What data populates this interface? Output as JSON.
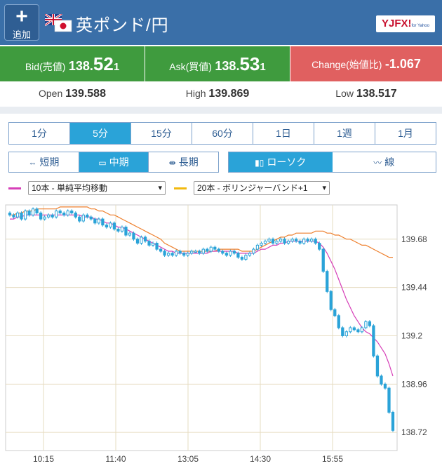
{
  "header": {
    "add_label": "追加",
    "pair_title": "英ポンド/円",
    "logo_text": "YJFX!",
    "logo_sub": "for Yahoo"
  },
  "quote": {
    "bid_label": "Bid(売値)",
    "bid_prefix": "138.",
    "bid_big": "52",
    "bid_small": "1",
    "ask_label": "Ask(買値)",
    "ask_prefix": "138.",
    "ask_big": "53",
    "ask_small": "1",
    "change_label": "Change(始値比)",
    "change_value": "-1.067",
    "colors": {
      "bid_ask_bg": "#3f9b3e",
      "change_bg": "#e06060"
    }
  },
  "stats": {
    "open_label": "Open",
    "open_value": "139.588",
    "high_label": "High",
    "high_value": "139.869",
    "low_label": "Low",
    "low_value": "138.517"
  },
  "timeframes": [
    "1分",
    "5分",
    "15分",
    "60分",
    "1日",
    "1週",
    "1月"
  ],
  "active_timeframe": "5分",
  "terms": [
    {
      "icon": "arrows-in-icon",
      "label": "短期"
    },
    {
      "icon": "window-icon",
      "label": "中期"
    },
    {
      "icon": "arrows-out-icon",
      "label": "長期"
    }
  ],
  "active_term": "中期",
  "chart_styles": [
    {
      "icon": "candlestick-icon",
      "label": "ローソク"
    },
    {
      "icon": "line-chart-icon",
      "label": "線"
    }
  ],
  "active_style": "ローソク",
  "indicators": [
    {
      "selected": "10本 - 単純平均移動",
      "color": "#d63fb8"
    },
    {
      "selected": "20本 - ボリンジャーバンド+1",
      "color": "#f2b90f"
    }
  ],
  "chart_data": {
    "type": "candlestick",
    "x_tick_labels": [
      "10:15",
      "11:40",
      "13:05",
      "14:30",
      "15:55"
    ],
    "y_tick_labels": [
      "139.68",
      "139.44",
      "139.2",
      "138.96",
      "138.72"
    ],
    "y_ticks": [
      139.68,
      139.44,
      139.2,
      138.96,
      138.72
    ],
    "ylim": [
      138.63,
      139.85
    ],
    "grid": true,
    "candle_color": "#2aa3d8",
    "close_series": [
      139.8,
      139.79,
      139.81,
      139.78,
      139.82,
      139.8,
      139.83,
      139.81,
      139.78,
      139.79,
      139.8,
      139.79,
      139.82,
      139.81,
      139.8,
      139.82,
      139.81,
      139.79,
      139.77,
      139.8,
      139.79,
      139.78,
      139.76,
      139.78,
      139.75,
      139.74,
      139.76,
      139.73,
      139.72,
      139.74,
      139.7,
      139.71,
      139.68,
      139.66,
      139.69,
      139.67,
      139.65,
      139.66,
      139.63,
      139.62,
      139.6,
      139.61,
      139.6,
      139.62,
      139.61,
      139.6,
      139.61,
      139.62,
      139.62,
      139.61,
      139.63,
      139.62,
      139.64,
      139.63,
      139.62,
      139.61,
      139.6,
      139.62,
      139.61,
      139.59,
      139.58,
      139.6,
      139.61,
      139.63,
      139.65,
      139.66,
      139.67,
      139.68,
      139.66,
      139.67,
      139.68,
      139.66,
      139.67,
      139.68,
      139.67,
      139.66,
      139.68,
      139.67,
      139.68,
      139.66,
      139.63,
      139.52,
      139.42,
      139.33,
      139.3,
      139.24,
      139.2,
      139.22,
      139.24,
      139.23,
      139.22,
      139.24,
      139.27,
      139.25,
      139.1,
      139.0,
      138.96,
      138.94,
      138.82,
      138.73
    ],
    "ma10": [
      139.78,
      139.78,
      139.79,
      139.79,
      139.8,
      139.8,
      139.8,
      139.8,
      139.8,
      139.8,
      139.8,
      139.8,
      139.8,
      139.8,
      139.8,
      139.8,
      139.8,
      139.8,
      139.8,
      139.79,
      139.79,
      139.79,
      139.78,
      139.78,
      139.77,
      139.76,
      139.76,
      139.75,
      139.74,
      139.74,
      139.73,
      139.72,
      139.71,
      139.7,
      139.69,
      139.68,
      139.67,
      139.66,
      139.65,
      139.64,
      139.63,
      139.62,
      139.62,
      139.61,
      139.61,
      139.61,
      139.61,
      139.61,
      139.61,
      139.61,
      139.61,
      139.61,
      139.62,
      139.62,
      139.62,
      139.62,
      139.62,
      139.62,
      139.62,
      139.61,
      139.61,
      139.61,
      139.61,
      139.61,
      139.62,
      139.63,
      139.63,
      139.64,
      139.65,
      139.65,
      139.66,
      139.66,
      139.67,
      139.67,
      139.67,
      139.67,
      139.67,
      139.67,
      139.67,
      139.67,
      139.66,
      139.64,
      139.61,
      139.57,
      139.53,
      139.48,
      139.43,
      139.38,
      139.34,
      139.3,
      139.27,
      139.24,
      139.22,
      139.21,
      139.19,
      139.17,
      139.14,
      139.11,
      139.06,
      139.0
    ],
    "boll_upper": [
      139.8,
      139.8,
      139.81,
      139.81,
      139.82,
      139.82,
      139.82,
      139.83,
      139.83,
      139.83,
      139.83,
      139.83,
      139.83,
      139.84,
      139.84,
      139.84,
      139.84,
      139.84,
      139.84,
      139.84,
      139.84,
      139.83,
      139.83,
      139.82,
      139.82,
      139.81,
      139.8,
      139.8,
      139.79,
      139.78,
      139.77,
      139.76,
      139.75,
      139.74,
      139.73,
      139.72,
      139.71,
      139.7,
      139.69,
      139.68,
      139.66,
      139.65,
      139.64,
      139.63,
      139.62,
      139.62,
      139.62,
      139.62,
      139.62,
      139.62,
      139.62,
      139.62,
      139.62,
      139.62,
      139.63,
      139.63,
      139.63,
      139.63,
      139.63,
      139.63,
      139.62,
      139.62,
      139.62,
      139.62,
      139.63,
      139.64,
      139.65,
      139.66,
      139.67,
      139.68,
      139.69,
      139.69,
      139.7,
      139.7,
      139.71,
      139.71,
      139.71,
      139.71,
      139.71,
      139.72,
      139.72,
      139.72,
      139.71,
      139.71,
      139.7,
      139.7,
      139.69,
      139.68,
      139.68,
      139.67,
      139.66,
      139.65,
      139.65,
      139.64,
      139.63,
      139.62,
      139.61,
      139.6,
      139.59,
      139.59
    ]
  }
}
